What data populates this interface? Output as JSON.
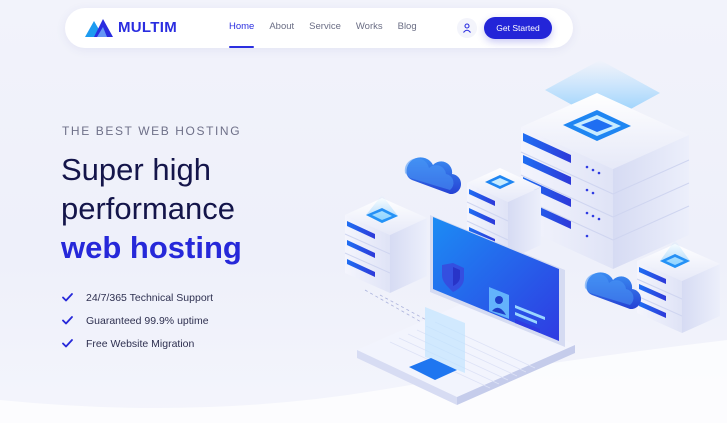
{
  "brand": {
    "name": "MULTIM",
    "color": "#2a2de0"
  },
  "nav": {
    "links": [
      {
        "label": "Home",
        "active": true
      },
      {
        "label": "About",
        "active": false
      },
      {
        "label": "Service",
        "active": false
      },
      {
        "label": "Works",
        "active": false
      },
      {
        "label": "Blog",
        "active": false
      }
    ],
    "user_icon": "user-icon",
    "cta_label": "Get Started"
  },
  "hero": {
    "eyebrow": "THE BEST WEB HOSTING",
    "headline_line1": "Super high",
    "headline_line2": "performance",
    "headline_accent": "web hosting",
    "features": [
      "24/7/365 Technical Support",
      "Guaranteed 99.9% uptime",
      "Free Website Migration"
    ],
    "feature_icon": "check-icon"
  },
  "colors": {
    "accent": "#2628d9",
    "heading": "#14154a",
    "background": "#f2f3fb"
  }
}
